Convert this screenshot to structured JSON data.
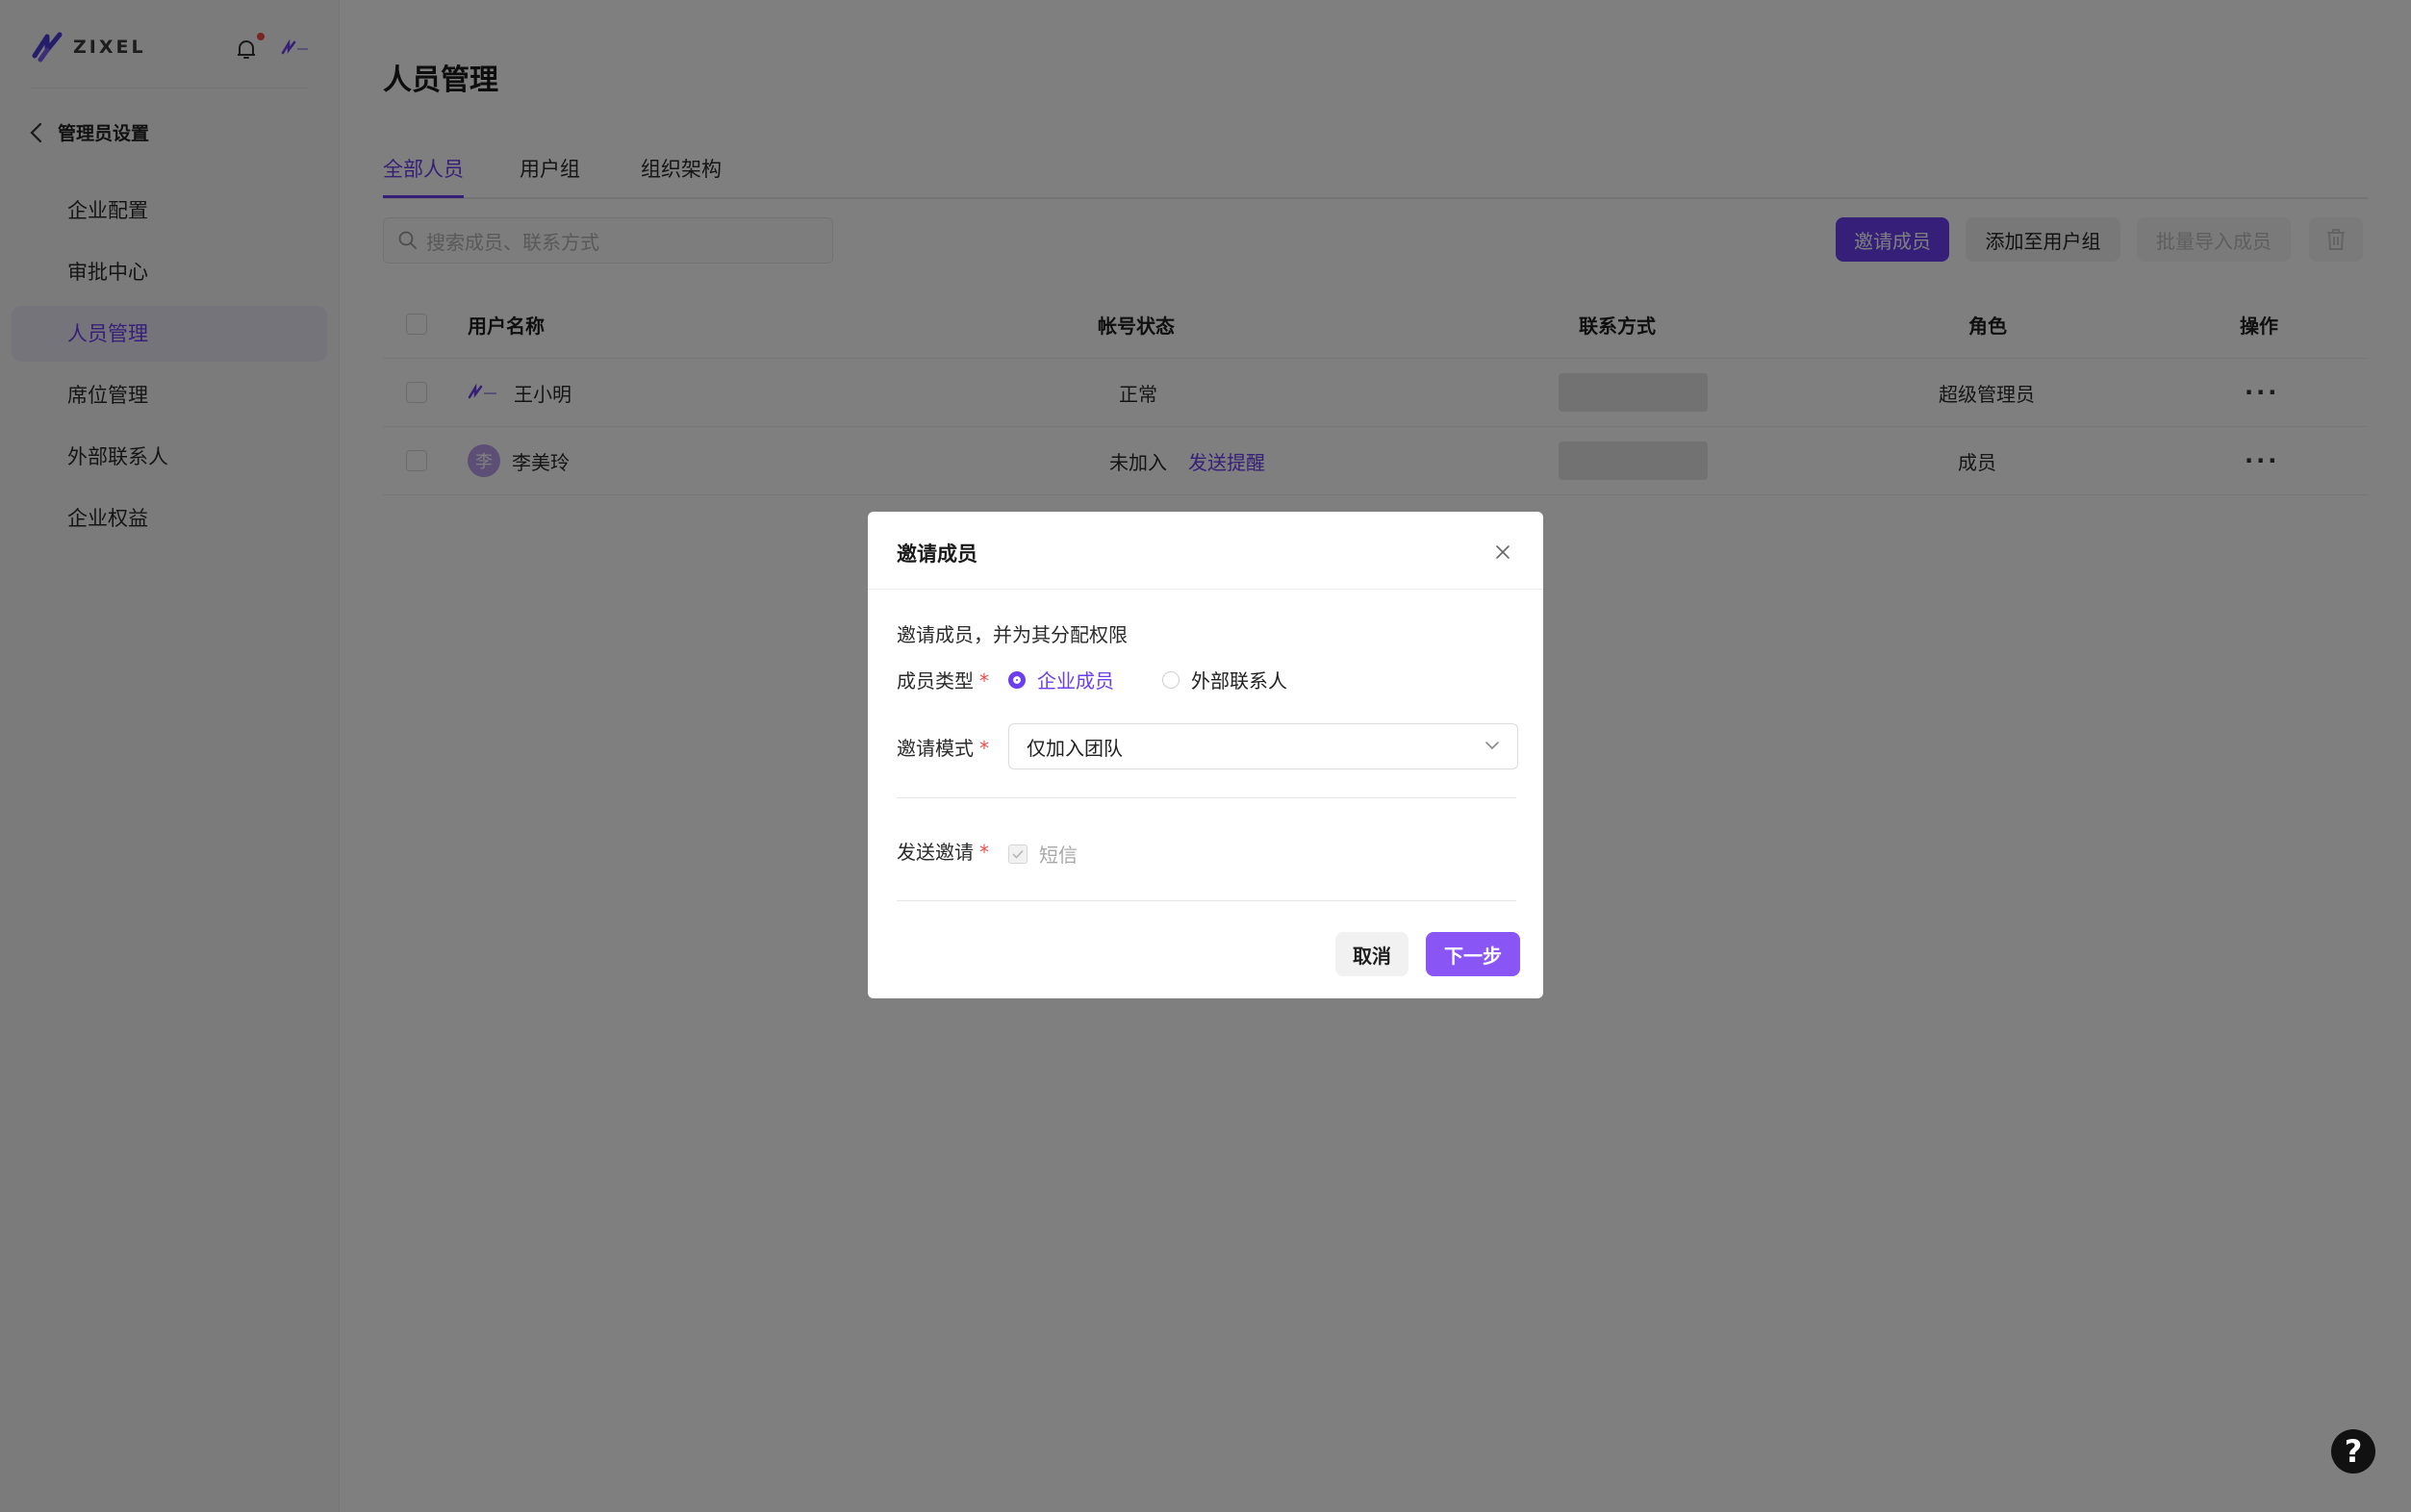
{
  "brand": {
    "name": "ZIXEL",
    "accent": "#6b3ff0"
  },
  "sidebar": {
    "back_label": "管理员设置",
    "items": [
      {
        "label": "企业配置"
      },
      {
        "label": "审批中心"
      },
      {
        "label": "人员管理",
        "active": true
      },
      {
        "label": "席位管理"
      },
      {
        "label": "外部联系人"
      },
      {
        "label": "企业权益"
      }
    ]
  },
  "main": {
    "title": "人员管理",
    "tabs": [
      {
        "label": "全部人员",
        "active": true
      },
      {
        "label": "用户组"
      },
      {
        "label": "组织架构"
      }
    ],
    "search_placeholder": "搜索成员、联系方式",
    "toolbar": {
      "invite": "邀请成员",
      "add_to_group": "添加至用户组",
      "bulk_import": "批量导入成员"
    },
    "table": {
      "headers": [
        "用户名称",
        "帐号状态",
        "联系方式",
        "角色",
        "操作"
      ],
      "rows": [
        {
          "name": "王小明",
          "status": "正常",
          "action_link": "",
          "role": "超级管理员",
          "actions": "···"
        },
        {
          "name": "李美玲",
          "avatar": "李",
          "status": "未加入",
          "action_link": "发送提醒",
          "role": "成员",
          "actions": "···"
        }
      ]
    }
  },
  "modal": {
    "title": "邀请成员",
    "description": "邀请成员，并为其分配权限",
    "member_type_label": "成员类型",
    "member_type_options": [
      "企业成员",
      "外部联系人"
    ],
    "member_type_selected": "企业成员",
    "invite_mode_label": "邀请模式",
    "invite_mode_value": "仅加入团队",
    "send_invite_label": "发送邀请",
    "send_invite_option": "短信",
    "required_mark": "*",
    "cancel": "取消",
    "next": "下一步"
  },
  "help_label": "?"
}
